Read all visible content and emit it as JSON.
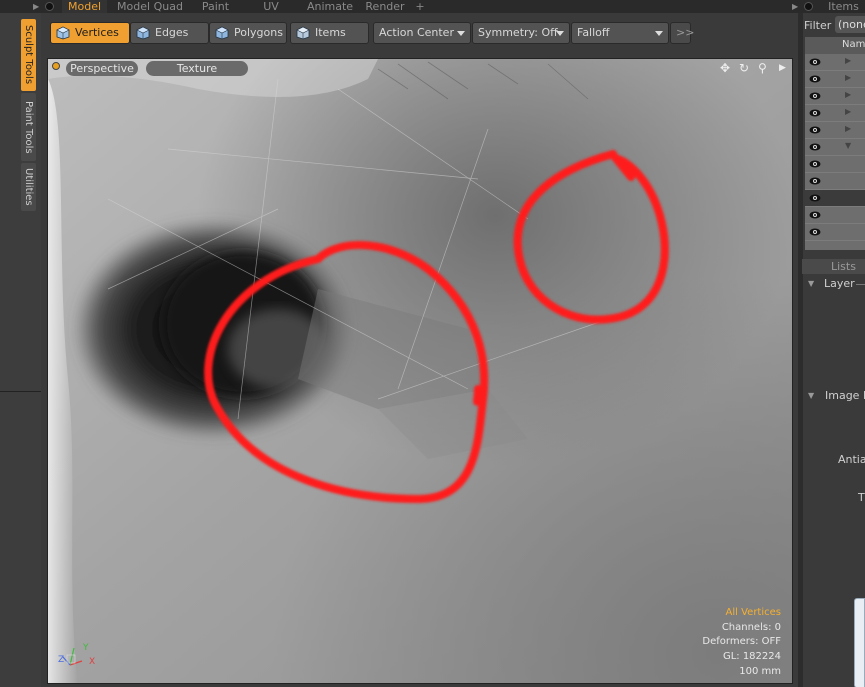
{
  "top_tabs": [
    {
      "label": "Model",
      "active": true
    },
    {
      "label": "Model Quad"
    },
    {
      "label": "Paint"
    },
    {
      "label": "UV"
    },
    {
      "label": "Animate"
    },
    {
      "label": "Render"
    },
    {
      "label": "+"
    }
  ],
  "right_tab": "Items",
  "side_tabs": [
    "Sculpt Tools",
    "Paint Tools",
    "Utilities"
  ],
  "toolbar": {
    "vertices": "Vertices",
    "edges": "Edges",
    "polygons": "Polygons",
    "items": "Items",
    "action_center": "Action Center",
    "symmetry": "Symmetry: Off",
    "falloff": "Falloff",
    "more": ">>"
  },
  "viewport": {
    "view_mode": "Perspective",
    "shading": "Texture",
    "info": {
      "selection": "All Vertices",
      "channels": "Channels: 0",
      "deformers": "Deformers: OFF",
      "gl": "GL: 182224",
      "scale": "100 mm"
    },
    "axes": {
      "x": "X",
      "y": "Y",
      "z": "Z"
    }
  },
  "item_list": {
    "filter_label": "Filter",
    "filter_value": "(none)",
    "header": "Name",
    "rows": [
      {
        "expander": "▶"
      },
      {
        "expander": "▶"
      },
      {
        "expander": "▶"
      },
      {
        "expander": "▶"
      },
      {
        "expander": "▶"
      },
      {
        "expander": "▼"
      },
      {
        "expander": ""
      },
      {
        "expander": ""
      },
      {
        "expander": "",
        "selected": true
      },
      {
        "expander": ""
      },
      {
        "expander": ""
      }
    ]
  },
  "properties": {
    "lists_tab": "Lists",
    "layer": "Layer",
    "image_map": "Image M",
    "antialias": "Antial",
    "truncated": "T"
  },
  "colors": {
    "accent": "#f0a030",
    "annotation": "#ff1a1a"
  }
}
